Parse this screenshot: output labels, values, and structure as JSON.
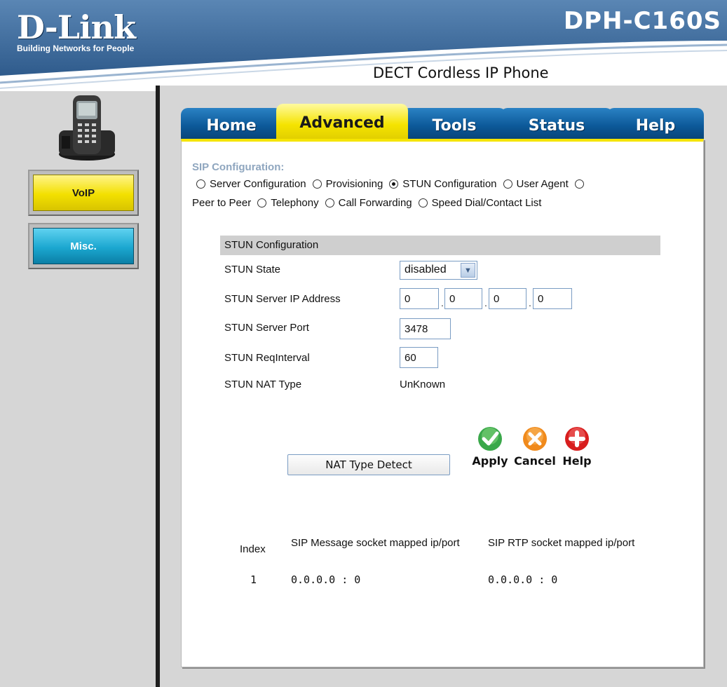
{
  "header": {
    "logo": "D-Link",
    "tagline": "Building Networks for People",
    "model": "DPH-C160S",
    "product": "DECT Cordless IP Phone"
  },
  "sidebar": {
    "items": [
      {
        "label": "VoIP",
        "color": "#f3e000"
      },
      {
        "label": "Misc.",
        "color": "#1ba7d0"
      }
    ]
  },
  "tabs": [
    "Home",
    "Advanced",
    "Tools",
    "Status",
    "Help"
  ],
  "active_tab": "Advanced",
  "sip": {
    "title": "SIP Configuration:",
    "options": [
      {
        "label": "Server Configuration",
        "selected": false
      },
      {
        "label": "Provisioning",
        "selected": false
      },
      {
        "label": "STUN Configuration",
        "selected": true
      },
      {
        "label": "User Agent",
        "selected": false
      },
      {
        "label": "Peer to Peer",
        "selected": false
      },
      {
        "label": "Telephony",
        "selected": false
      },
      {
        "label": "Call Forwarding",
        "selected": false
      },
      {
        "label": "Speed Dial/Contact List",
        "selected": false
      }
    ]
  },
  "stun": {
    "section_title": "STUN Configuration",
    "state_label": "STUN State",
    "state_value": "disabled",
    "ip_label": "STUN Server IP Address",
    "ip": [
      "0",
      "0",
      "0",
      "0"
    ],
    "port_label": "STUN Server Port",
    "port_value": "3478",
    "interval_label": "STUN ReqInterval",
    "interval_value": "60",
    "nat_label": "STUN NAT Type",
    "nat_value": "UnKnown"
  },
  "actions": {
    "nat_detect": "NAT Type Detect",
    "apply": "Apply",
    "cancel": "Cancel",
    "help": "Help"
  },
  "table": {
    "headers": {
      "index": "Index",
      "sip_msg": "SIP Message socket mapped ip/port",
      "sip_rtp": "SIP RTP socket mapped ip/port"
    },
    "rows": [
      {
        "index": "1",
        "sip_msg": "0.0.0.0 : 0",
        "sip_rtp": "0.0.0.0 : 0"
      }
    ]
  },
  "colors": {
    "header_blue": "#3f6b9c",
    "tab_blue": "#0c5898",
    "tab_active": "#f5e400",
    "sidebar_gray": "#d6d6d6"
  }
}
